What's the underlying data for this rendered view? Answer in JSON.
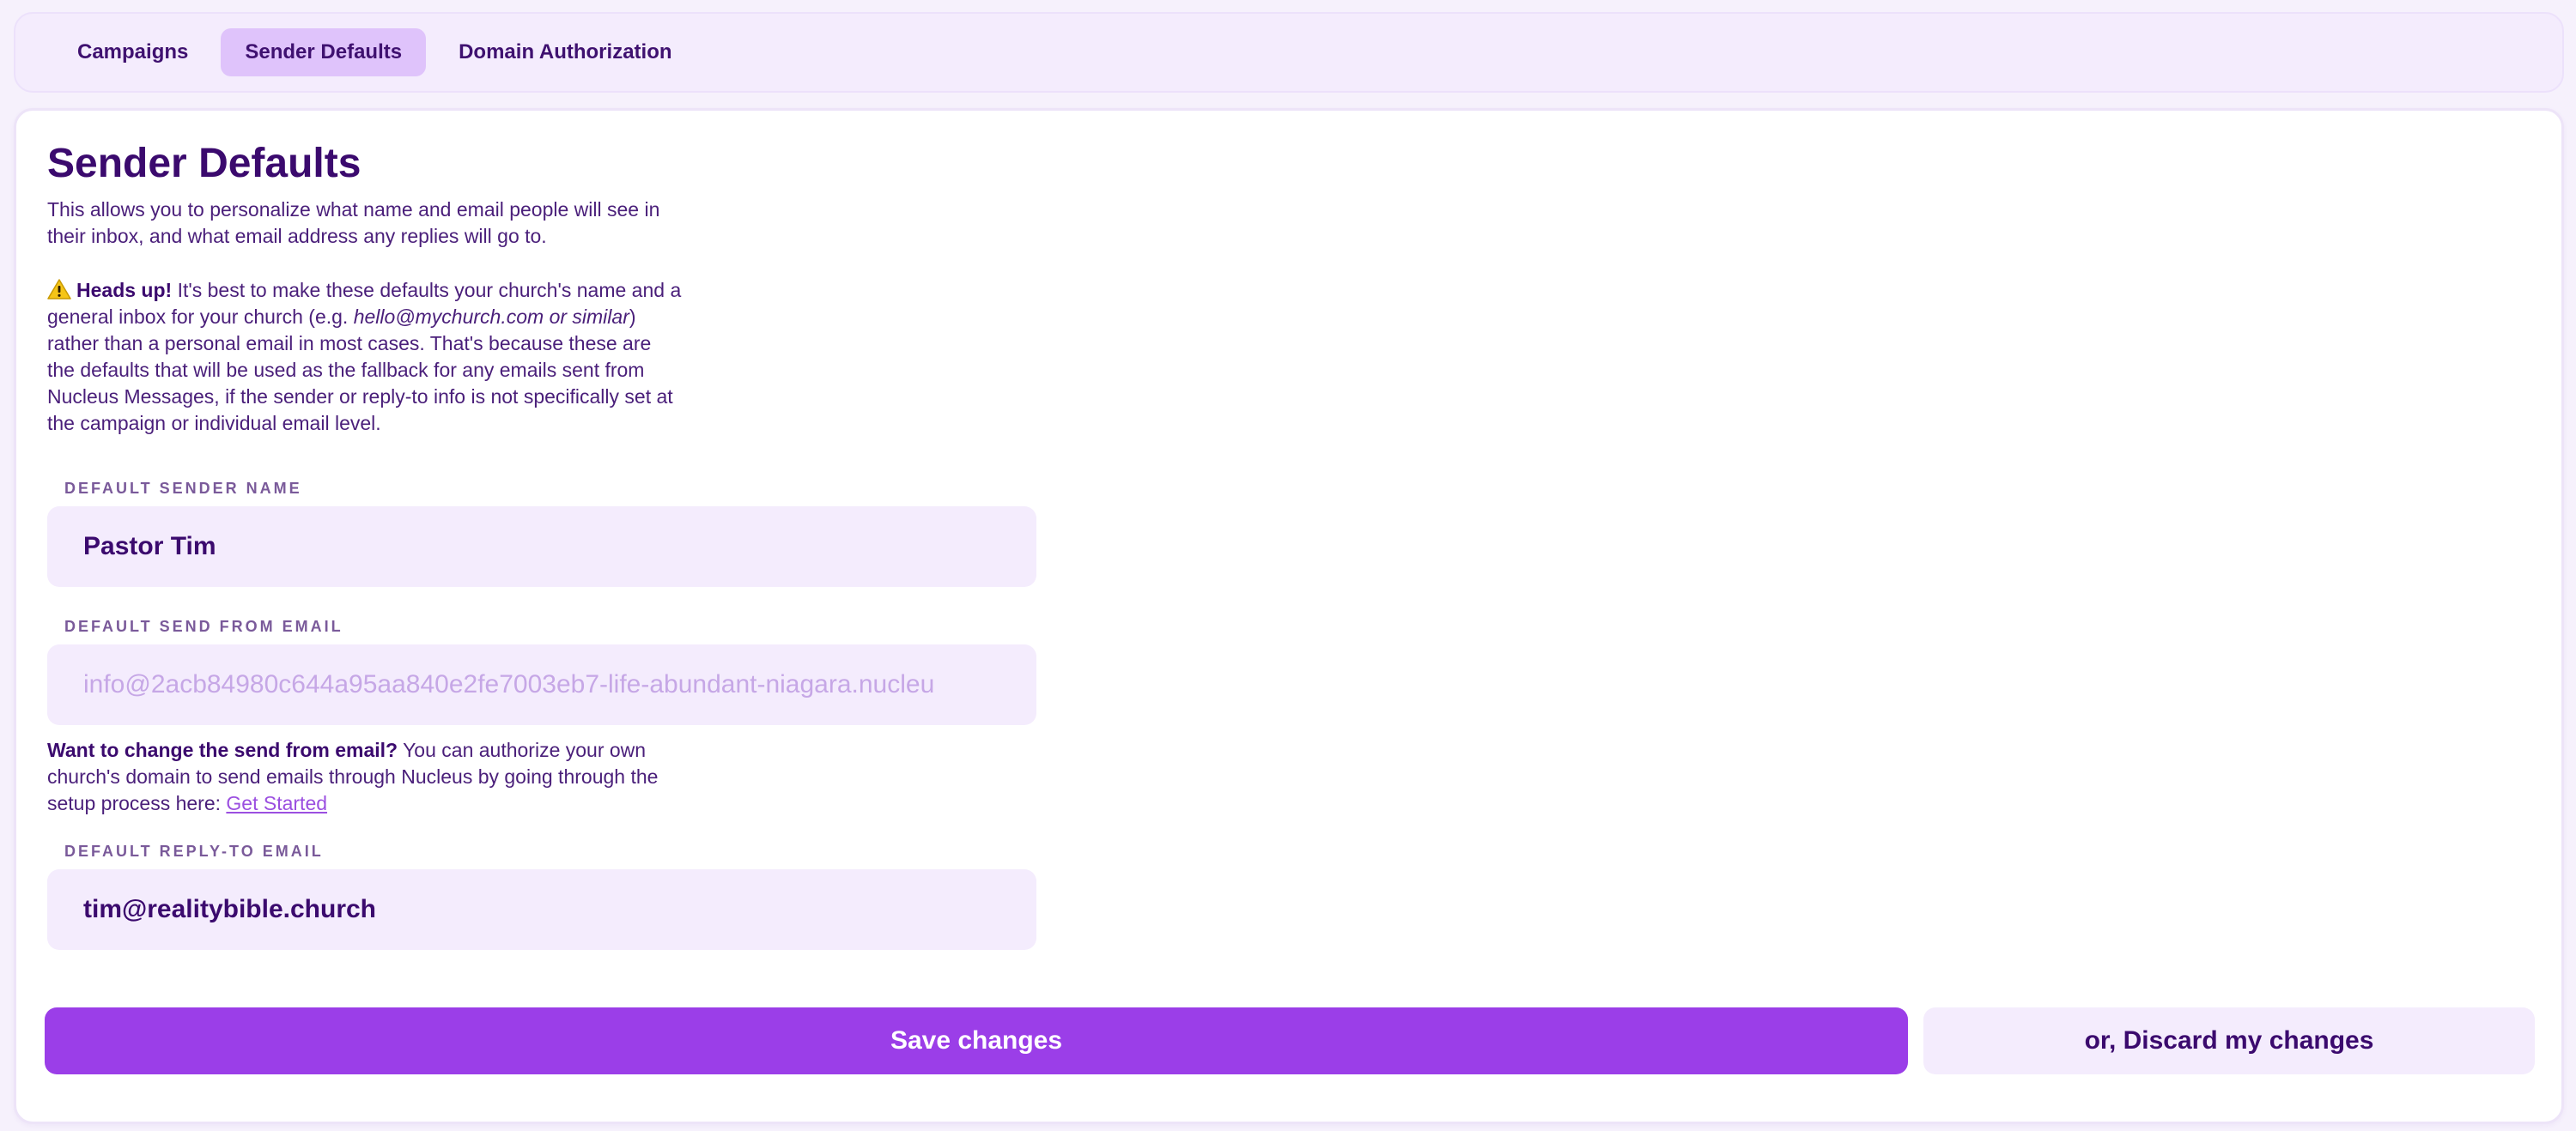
{
  "tabs": [
    {
      "label": "Campaigns",
      "active": false
    },
    {
      "label": "Sender Defaults",
      "active": true
    },
    {
      "label": "Domain Authorization",
      "active": false
    }
  ],
  "page": {
    "title": "Sender Defaults",
    "intro": "This allows you to personalize what name and email people will see in their inbox, and what email address any replies will go to.",
    "warning": {
      "icon": "warning-icon",
      "heading": "Heads up!",
      "text_1": " It's best to make these defaults your church's name and a general inbox for your church (e.g. ",
      "example": "hello@mychurch.com or similar",
      "text_2": ") rather than a personal email in most cases. That's because these are the defaults that will be used as the fallback for any emails sent from Nucleus Messages, if the sender or reply-to info is not specifically set at the campaign or individual email level."
    }
  },
  "fields": {
    "sender_name": {
      "label": "Default Sender Name",
      "value": "Pastor Tim"
    },
    "send_from": {
      "label": "Default Send From Email",
      "value": "info@2acb84980c644a95aa840e2fe7003eb7-life-abundant-niagara.nucleu",
      "help_bold": "Want to change the send from email?",
      "help_text": " You can authorize your own church's domain to send emails through Nucleus by going through the setup process here: ",
      "help_link": "Get Started"
    },
    "reply_to": {
      "label": "Default Reply-To Email",
      "value": "tim@realitybible.church"
    }
  },
  "actions": {
    "save_label": "Save changes",
    "discard_label": "or, Discard my changes"
  },
  "colors": {
    "accent": "#9b3ee8",
    "text": "#3b0a6e",
    "field_bg": "#f4ecfd",
    "tab_active_bg": "#dfc3fb"
  }
}
